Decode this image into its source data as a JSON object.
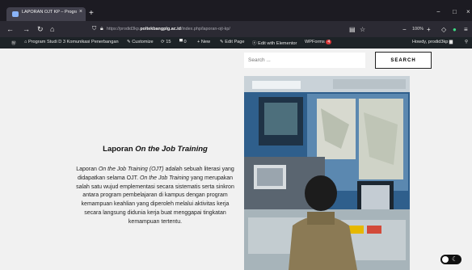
{
  "browser": {
    "tab_title": "LAPORAN OJT KP – Program St",
    "tab_close": "×",
    "new_tab": "+",
    "window_min": "−",
    "window_max": "□",
    "window_close": "×",
    "url_prefix": "https://prodid3kp.",
    "url_domain": "poltekbangplg.ac.id",
    "url_path": "/index.php/laporan-ojt-kp/",
    "zoom": "100%"
  },
  "admin_bar": {
    "site_name": "Program Studi D 3 Komunikasi Penerbangan",
    "customize": "Customize",
    "updates_count": "15",
    "comments_count": "0",
    "new": "New",
    "edit_page": "Edit Page",
    "edit_elementor": "Edit with Elementor",
    "wpforms": "WPForms",
    "wpforms_badge": "4",
    "howdy": "Howdy, prodid3kp"
  },
  "search": {
    "placeholder": "Search ...",
    "button_label": "SEARCH"
  },
  "main": {
    "heading_prefix": "Laporan ",
    "heading_italic": "On the Job Training",
    "para_1": "Laporan ",
    "para_2": "On the Job Training (OJT)",
    "para_3": " adalah sebuah literasi yang didapatkan selama OJT. ",
    "para_4": "On the Job Training",
    "para_5": " yang merupakan salah satu wujud emplementasi secara sistematis serta sinkron antara program pembelajaran di kampus dengan program kemampuan keahlian yang diperoleh melalui aktivitas kerja secara langsung didunia kerja buat menggapai tingkatan kemampuan tertentu."
  },
  "colors": {
    "tabbar": "#1c1b22",
    "navbar": "#2b2a33",
    "adminbar": "#1d2327",
    "page_bg": "#f1f1f1",
    "badge": "#d63638"
  },
  "icons": {
    "back": "back-icon",
    "forward": "forward-icon",
    "reload": "reload-icon",
    "home": "home-icon",
    "toggle": "dark-mode-toggle-icon"
  }
}
